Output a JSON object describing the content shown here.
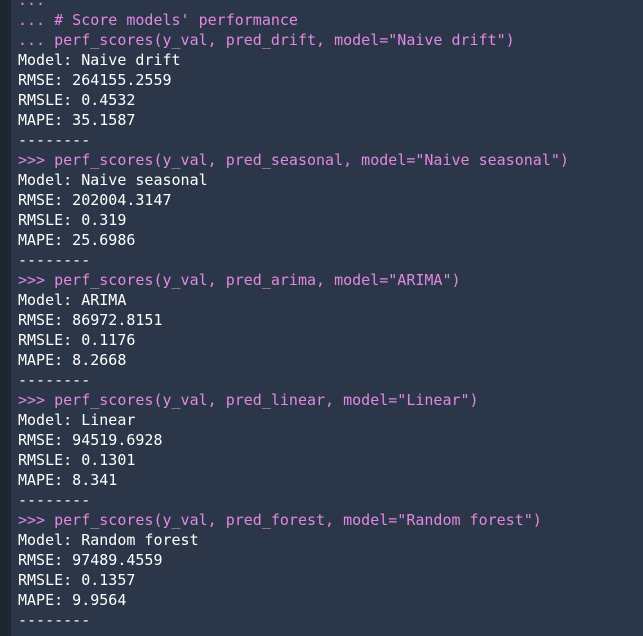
{
  "console": {
    "lines": [
      {
        "text": "...",
        "kind": "cmd"
      },
      {
        "text": "... # Score models' performance",
        "kind": "cmd"
      },
      {
        "text": "... perf_scores(y_val, pred_drift, model=\"Naive drift\")",
        "kind": "cmd"
      },
      {
        "text": "Model: Naive drift",
        "kind": "out"
      },
      {
        "text": "RMSE: 264155.2559",
        "kind": "out"
      },
      {
        "text": "RMSLE: 0.4532",
        "kind": "out"
      },
      {
        "text": "MAPE: 35.1587",
        "kind": "out"
      },
      {
        "text": "--------",
        "kind": "out"
      },
      {
        "text": ">>> perf_scores(y_val, pred_seasonal, model=\"Naive seasonal\")",
        "kind": "cmd"
      },
      {
        "text": "Model: Naive seasonal",
        "kind": "out"
      },
      {
        "text": "RMSE: 202004.3147",
        "kind": "out"
      },
      {
        "text": "RMSLE: 0.319",
        "kind": "out"
      },
      {
        "text": "MAPE: 25.6986",
        "kind": "out"
      },
      {
        "text": "--------",
        "kind": "out"
      },
      {
        "text": ">>> perf_scores(y_val, pred_arima, model=\"ARIMA\")",
        "kind": "cmd"
      },
      {
        "text": "Model: ARIMA",
        "kind": "out"
      },
      {
        "text": "RMSE: 86972.8151",
        "kind": "out"
      },
      {
        "text": "RMSLE: 0.1176",
        "kind": "out"
      },
      {
        "text": "MAPE: 8.2668",
        "kind": "out"
      },
      {
        "text": "--------",
        "kind": "out"
      },
      {
        "text": ">>> perf_scores(y_val, pred_linear, model=\"Linear\")",
        "kind": "cmd"
      },
      {
        "text": "Model: Linear",
        "kind": "out"
      },
      {
        "text": "RMSE: 94519.6928",
        "kind": "out"
      },
      {
        "text": "RMSLE: 0.1301",
        "kind": "out"
      },
      {
        "text": "MAPE: 8.341",
        "kind": "out"
      },
      {
        "text": "--------",
        "kind": "out"
      },
      {
        "text": ">>> perf_scores(y_val, pred_forest, model=\"Random forest\")",
        "kind": "cmd"
      },
      {
        "text": "Model: Random forest",
        "kind": "out"
      },
      {
        "text": "RMSE: 97489.4559",
        "kind": "out"
      },
      {
        "text": "RMSLE: 0.1357",
        "kind": "out"
      },
      {
        "text": "MAPE: 9.9564",
        "kind": "out"
      },
      {
        "text": "--------",
        "kind": "out"
      }
    ]
  },
  "colors": {
    "background": "#2b3748",
    "gutter": "#1e2632",
    "command_text": "#e287e2",
    "output_text": "#ffffff"
  }
}
